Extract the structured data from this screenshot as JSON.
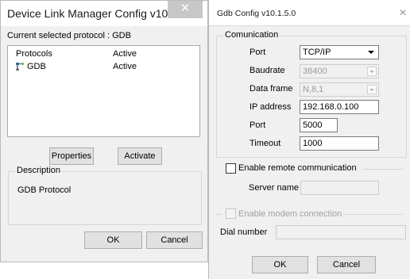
{
  "left_window": {
    "title": "Device Link Manager Config v10....",
    "close_glyph": "✕",
    "current_protocol_label": "Current selected protocol : GDB",
    "list": {
      "columns": [
        "Protocols",
        "Active"
      ],
      "rows": [
        {
          "protocol": "GDB",
          "active": "Active",
          "icon": "plug-icon"
        }
      ]
    },
    "properties_button": "Properties",
    "activate_button": "Activate",
    "description_title": "Description",
    "description_text": "GDB Protocol",
    "ok_button": "OK",
    "cancel_button": "Cancel"
  },
  "right_window": {
    "title": "Gdb Config v10.1.5.0",
    "close_glyph": "✕",
    "communication": {
      "group_title": "Comunication",
      "port_type_label": "Port",
      "port_type_value": "TCP/IP",
      "baudrate_label": "Baudrate",
      "baudrate_value": "38400",
      "data_frame_label": "Data frame",
      "data_frame_value": "N,8,1",
      "ip_label": "IP address",
      "ip_value": "192.168.0.100",
      "port_label": "Port",
      "port_value": "5000",
      "timeout_label": "Timeout",
      "timeout_value": "1000"
    },
    "remote": {
      "checkbox_label": "Enable remote communication",
      "checked": false,
      "server_name_label": "Server name",
      "server_name_value": ""
    },
    "modem": {
      "checkbox_label": "Enable modem connection",
      "checked": false,
      "dial_number_label": "Dial number",
      "dial_number_value": ""
    },
    "ok_button": "OK",
    "cancel_button": "Cancel"
  },
  "colors": {
    "window_bg": "#f0f0f0",
    "button_bg": "#e1e1e1",
    "close_button_bg": "#c7c7c7"
  }
}
